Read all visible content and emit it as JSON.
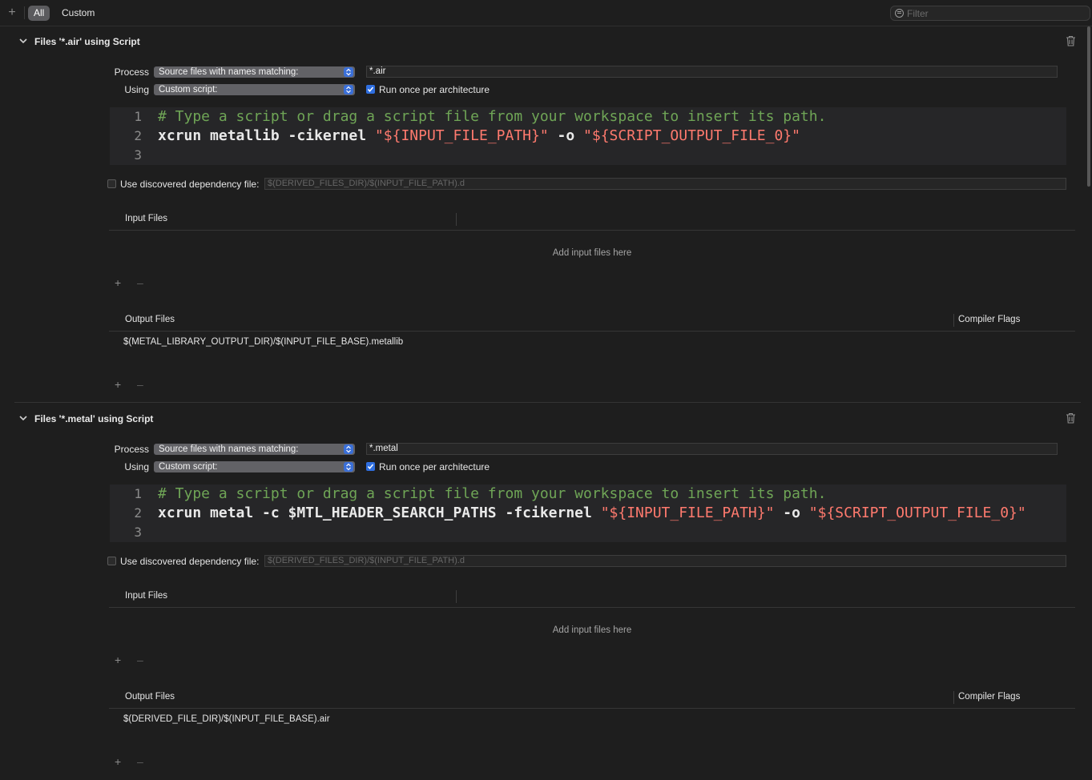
{
  "toolbar": {
    "add_icon": "plus-icon",
    "tabs": [
      {
        "label": "All",
        "active": true
      },
      {
        "label": "Custom",
        "active": false
      }
    ],
    "filter_placeholder": "Filter"
  },
  "rules": [
    {
      "title": "Files '*.air' using Script",
      "process_label": "Process",
      "process_value": "Source files with names matching:",
      "pattern": "*.air",
      "using_label": "Using",
      "using_value": "Custom script:",
      "run_once_label": "Run once per architecture",
      "run_once_checked": true,
      "script_line_numbers": [
        "1",
        "2",
        "3"
      ],
      "script_comment": "# Type a script or drag a script file from your workspace to insert its path.",
      "script_cmd": "xcrun metallib -cikernel ",
      "script_arg1": "\"${INPUT_FILE_PATH}\"",
      "script_mid": " -o ",
      "script_arg2": "\"${SCRIPT_OUTPUT_FILE_0}\"",
      "dependency_label": "Use discovered dependency file:",
      "dependency_checked": false,
      "dependency_placeholder": "$(DERIVED_FILES_DIR)/$(INPUT_FILE_PATH).d",
      "input_files_header": "Input Files",
      "input_files_empty": "Add input files here",
      "output_files_header": "Output Files",
      "compiler_flags_header": "Compiler Flags",
      "output_files": [
        "$(METAL_LIBRARY_OUTPUT_DIR)/$(INPUT_FILE_BASE).metallib"
      ]
    },
    {
      "title": "Files '*.metal' using Script",
      "process_label": "Process",
      "process_value": "Source files with names matching:",
      "pattern": "*.metal",
      "using_label": "Using",
      "using_value": "Custom script:",
      "run_once_label": "Run once per architecture",
      "run_once_checked": true,
      "script_line_numbers": [
        "1",
        "2",
        "3"
      ],
      "script_comment": "# Type a script or drag a script file from your workspace to insert its path.",
      "script_cmd": "xcrun metal -c $MTL_HEADER_SEARCH_PATHS -fcikernel ",
      "script_arg1": "\"${INPUT_FILE_PATH}\"",
      "script_mid": " -o ",
      "script_arg2": "\"${SCRIPT_OUTPUT_FILE_0}\"",
      "dependency_label": "Use discovered dependency file:",
      "dependency_checked": false,
      "dependency_placeholder": "$(DERIVED_FILES_DIR)/$(INPUT_FILE_PATH).d",
      "input_files_header": "Input Files",
      "input_files_empty": "Add input files here",
      "output_files_header": "Output Files",
      "compiler_flags_header": "Compiler Flags",
      "output_files": [
        "$(DERIVED_FILE_DIR)/$(INPUT_FILE_BASE).air"
      ]
    }
  ],
  "colors": {
    "background": "#1e1e1e",
    "comment": "#6fa556",
    "string": "#ff7a6e",
    "accent": "#2f6fe0"
  }
}
